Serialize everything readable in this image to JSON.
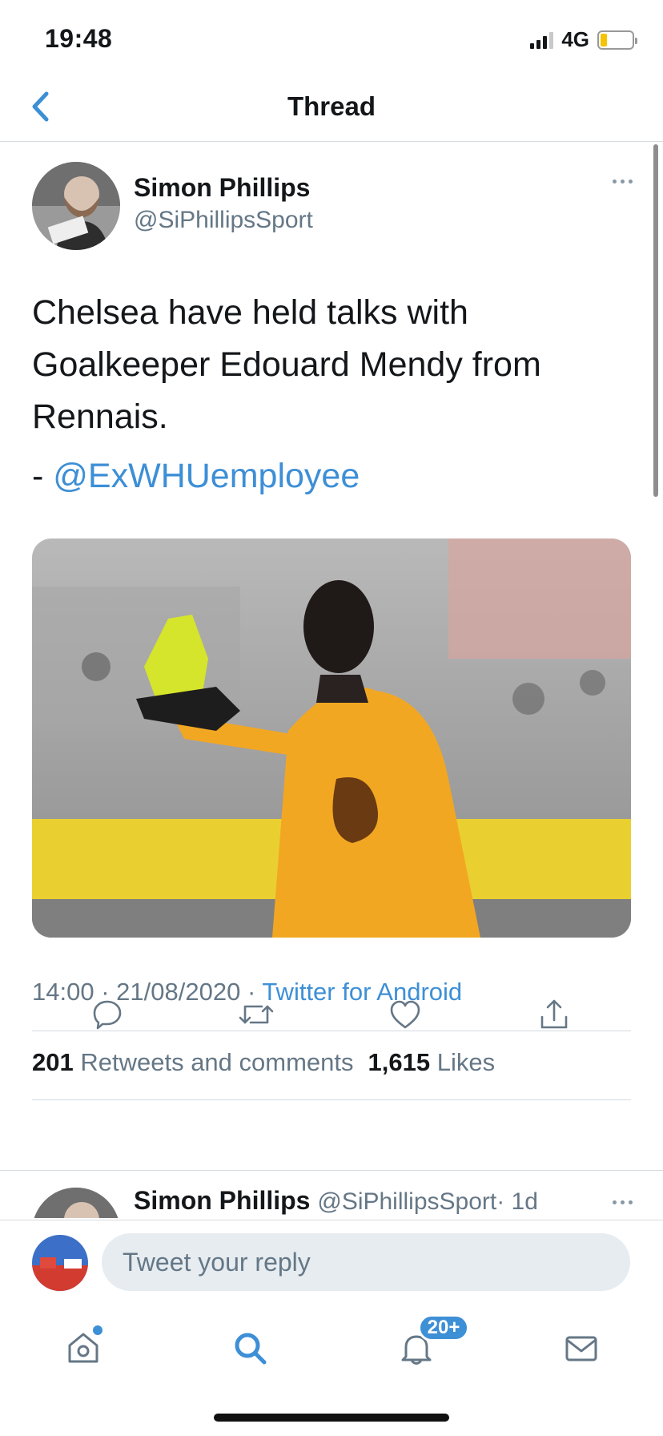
{
  "status_bar": {
    "time": "19:48",
    "network": "4G",
    "battery_level": 0.2
  },
  "header": {
    "title": "Thread",
    "back_icon": "chevron-left-icon"
  },
  "tweet": {
    "author_name": "Simon Phillips",
    "author_handle": "@SiPhillipsSport",
    "text": "Chelsea have held talks with Goalkeeper Edouard Mendy from Rennais.",
    "credit_prefix": "- ",
    "credit_mention": "@ExWHUemployee",
    "time": "14:00",
    "date": "21/08/2020",
    "separator": "·",
    "source": "Twitter for Android",
    "retweets_count": "201",
    "retweets_label": "Retweets and comments",
    "likes_count": "1,615",
    "likes_label": "Likes"
  },
  "actions": [
    {
      "name": "reply",
      "icon": "comment-icon"
    },
    {
      "name": "retweet",
      "icon": "retweet-icon"
    },
    {
      "name": "like",
      "icon": "heart-icon"
    },
    {
      "name": "share",
      "icon": "share-icon"
    }
  ],
  "next_tweet": {
    "author_name": "Simon Phillips",
    "author_handle": "@SiPhillipsSport",
    "age": "· 1d"
  },
  "reply": {
    "placeholder": "Tweet your reply"
  },
  "tab_bar": {
    "notifications_badge": "20+"
  },
  "colors": {
    "accent": "#3d8fd6",
    "text": "#14171a",
    "secondary_text": "#657786",
    "divider": "#d5dadf"
  }
}
